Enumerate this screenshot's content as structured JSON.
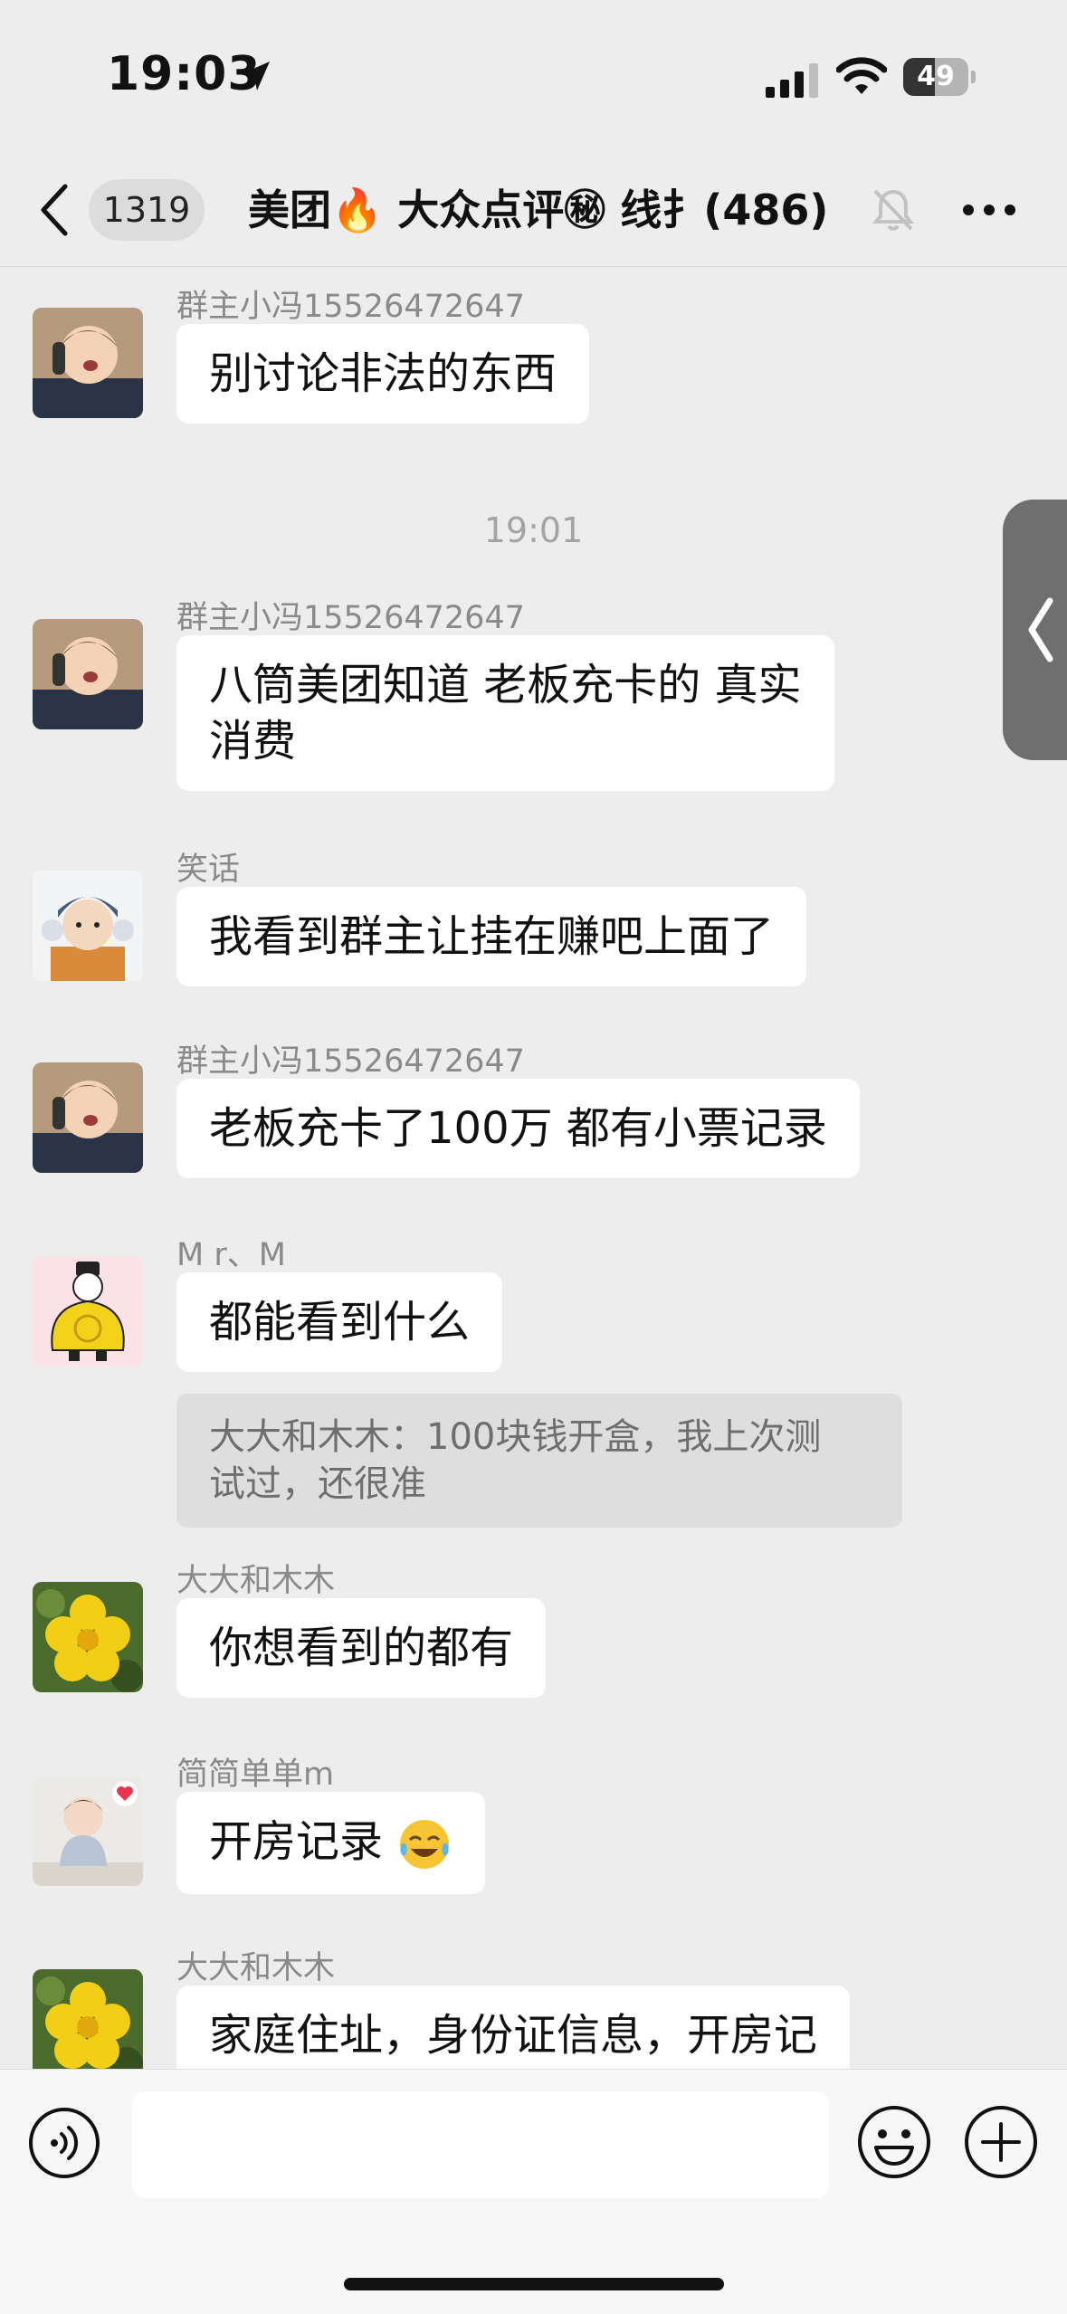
{
  "status_bar": {
    "time": "19:03",
    "battery": "49",
    "battery_level": 0.49
  },
  "nav": {
    "unread_count": "1319",
    "title": "美团🔥 大众点评㊙ 线扌(486)"
  },
  "messages": [
    {
      "type": "text",
      "sender": "群主小冯15526472647",
      "avatar": "toddler-phone-avatar",
      "text": "别讨论非法的东西"
    },
    {
      "type": "time",
      "text": "19:01"
    },
    {
      "type": "text",
      "sender": "群主小冯15526472647",
      "avatar": "toddler-phone-avatar",
      "line1": "八筒美团知道 老板充卡的 真实",
      "line2": "消费"
    },
    {
      "type": "text",
      "sender": "笑话",
      "avatar": "child-hat-avatar",
      "text": "我看到群主让挂在赚吧上面了"
    },
    {
      "type": "text",
      "sender": "群主小冯15526472647",
      "avatar": "toddler-phone-avatar",
      "text": "老板充卡了100万 都有小票记录"
    },
    {
      "type": "text",
      "sender": "M r、M",
      "avatar": "yellow-robe-cartoon-avatar",
      "text": "都能看到什么",
      "quote_line1": "大大和木木：100块钱开盒，我上次测",
      "quote_line2": "试过，还很准"
    },
    {
      "type": "text",
      "sender": "大大和木木",
      "avatar": "yellow-flower-avatar",
      "text": "你想看到的都有"
    },
    {
      "type": "text",
      "sender": "简简单单m",
      "avatar": "baby-heart-avatar",
      "text": "开房记录"
    },
    {
      "type": "text",
      "sender": "大大和木木",
      "avatar": "yellow-flower-avatar",
      "text": "家庭住址，身份证信息，开房记"
    }
  ],
  "input": {
    "placeholder": ""
  },
  "icons": {
    "back": "chevron-left-icon",
    "mute": "bell-muted-icon",
    "more": "more-dots-icon",
    "voice": "voice-icon",
    "emoji": "emoji-icon",
    "plus": "plus-icon",
    "side": "chevron-left-icon",
    "emoji_in_message": "crying-laughing-emoji"
  },
  "colors": {
    "background": "#ededed",
    "bubble": "#ffffff",
    "quote": "#dedede",
    "sender": "#8a8a8a"
  }
}
